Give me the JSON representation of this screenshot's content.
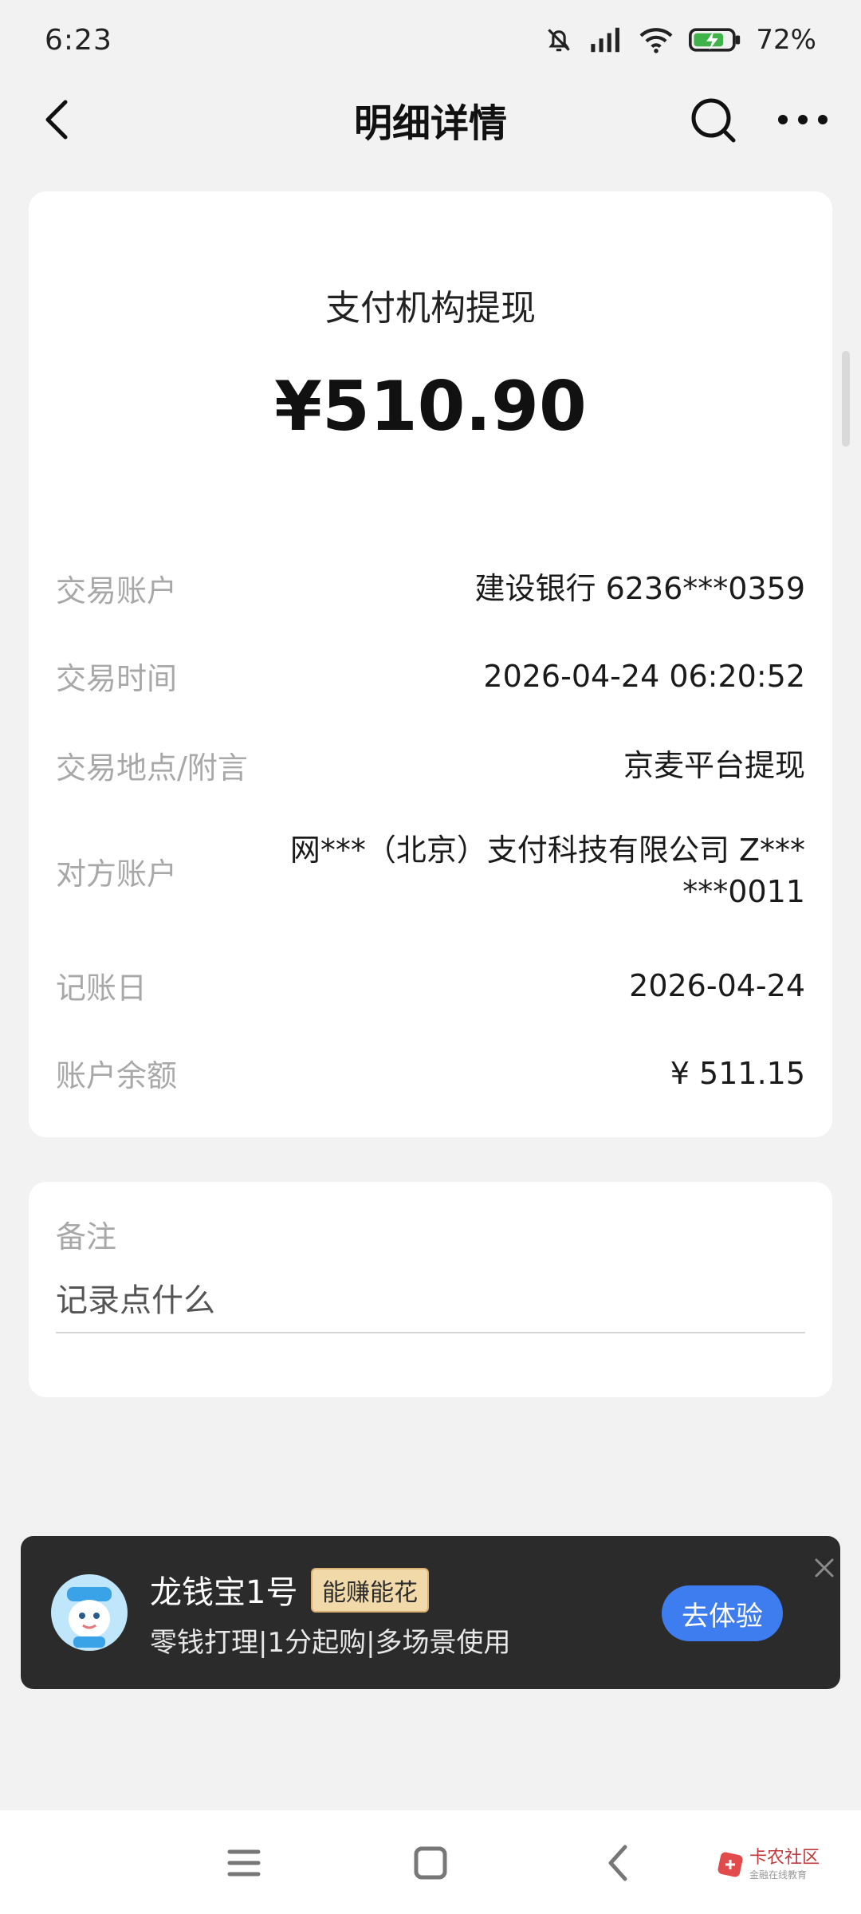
{
  "status_bar": {
    "time": "6:23",
    "battery": "72%"
  },
  "header": {
    "title": "明细详情",
    "back_icon": "chevron-left-icon",
    "search_icon": "search-icon",
    "more_icon": "more-dots-icon"
  },
  "transaction": {
    "type": "支付机构提现",
    "amount": "¥510.90",
    "rows": [
      {
        "label": "交易账户",
        "value": "建设银行 6236***0359"
      },
      {
        "label": "交易时间",
        "value": "2026-04-24 06:20:52"
      },
      {
        "label": "交易地点/附言",
        "value": "京麦平台提现"
      },
      {
        "label": "对方账户",
        "value_line1": "网***（北京）支付科技有限公司 Z***",
        "value_line2": "***0011"
      },
      {
        "label": "记账日",
        "value": "2026-04-24"
      },
      {
        "label": "账户余额",
        "value": "¥ 511.15"
      }
    ]
  },
  "note": {
    "label": "备注",
    "placeholder": "记录点什么"
  },
  "promo": {
    "title": "龙钱宝1号",
    "badge": "能赚能花",
    "subtitle": "零钱打理|1分起购|多场景使用",
    "cta": "去体验"
  },
  "watermark": {
    "text": "卡农社区",
    "sub": "金融在线教育"
  },
  "colors": {
    "background": "#f2f2f2",
    "card": "#ffffff",
    "promo_bg": "#2b2b2b",
    "cta": "#3e7df0",
    "label_gray": "#a8a8a8"
  }
}
